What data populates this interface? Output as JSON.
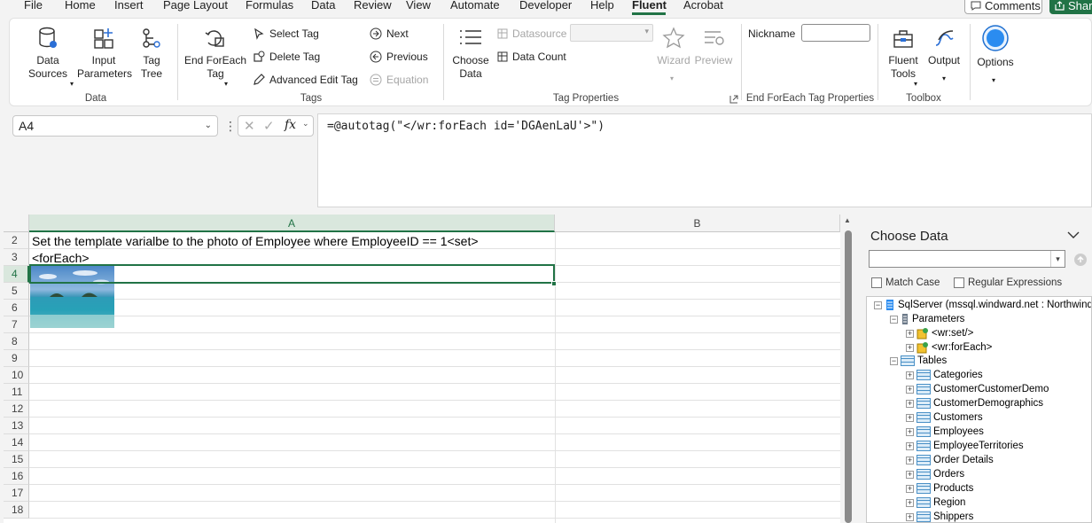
{
  "menu": {
    "items": [
      "File",
      "Home",
      "Insert",
      "Page Layout",
      "Formulas",
      "Data",
      "Review",
      "View",
      "Automate",
      "Developer",
      "Help",
      "Fluent",
      "Acrobat"
    ],
    "comments_label": "Comments",
    "share_label": "Shar"
  },
  "ribbon": {
    "data_group": {
      "label": "Data",
      "data_sources": "Data\nSources",
      "input_parameters": "Input\nParameters",
      "tag_trees": "Tag\nTree"
    },
    "tags_group": {
      "label": "Tags",
      "end_foreach": "End ForEach\nTag",
      "select_tag": "Select Tag",
      "delete_tag": "Delete Tag",
      "advanced_edit_tag": "Advanced Edit Tag",
      "next": "Next",
      "previous": "Previous",
      "equation": "Equation"
    },
    "tag_properties_group": {
      "label": "Tag Properties",
      "choose_data": "Choose\nData",
      "datasource": "Datasource",
      "data_count": "Data Count",
      "wizard": "Wizard",
      "preview": "Preview"
    },
    "end_foreach_props": {
      "label": "End ForEach Tag Properties",
      "nickname": "Nickname"
    },
    "toolbox": {
      "label": "Toolbox",
      "fluent_tools": "Fluent\nTools",
      "output": "Output"
    },
    "options": {
      "label": "Options"
    }
  },
  "formula_bar": {
    "name_box": "A4",
    "formula": "=@autotag(\"</wr:forEach id='DGAenLaU'>\")"
  },
  "sheet": {
    "columns": [
      "A",
      "B"
    ],
    "rows": [
      "2",
      "3",
      "4",
      "5",
      "6",
      "7",
      "8",
      "9",
      "10",
      "11",
      "12",
      "13",
      "14",
      "15",
      "16",
      "17",
      "18"
    ],
    "cell_a2": "Set the template varialbe to the photo of Employee where EmployeeID == 1<set>",
    "cell_a3": "<forEach>"
  },
  "panel": {
    "title": "Choose Data",
    "match_case": "Match Case",
    "regular_expressions": "Regular Expressions",
    "server": "SqlServer (mssql.windward.net : Northwind)",
    "parameters": "Parameters",
    "param_set": "<wr:set/>",
    "param_foreach": "<wr:forEach>",
    "tables": "Tables",
    "table_list": [
      "Categories",
      "CustomerCustomerDemo",
      "CustomerDemographics",
      "Customers",
      "Employees",
      "EmployeeTerritories",
      "Order Details",
      "Orders",
      "Products",
      "Region",
      "Shippers"
    ]
  },
  "colors": {
    "accent": "#217346",
    "selection": "#d9e7dd",
    "options_blue": "#1e90ff"
  }
}
